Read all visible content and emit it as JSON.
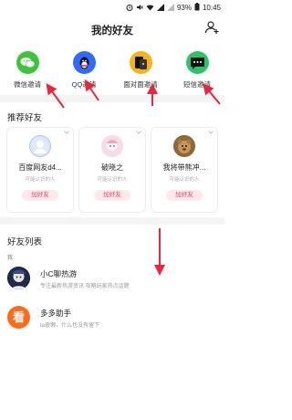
{
  "status_bar": {
    "battery_percent": "93%",
    "time": "10:45"
  },
  "header": {
    "title": "我的好友",
    "add_friend_icon": "person-add-icon"
  },
  "invites": [
    {
      "label": "微信邀请",
      "icon": "wechat-icon",
      "color": "#3ec43c"
    },
    {
      "label": "QQ邀请",
      "icon": "qq-icon",
      "color": "#2f6bff"
    },
    {
      "label": "面对面邀请",
      "icon": "face-to-face-icon",
      "color": "#f5b21a"
    },
    {
      "label": "短信邀请",
      "icon": "sms-icon",
      "color": "#2bc46c"
    }
  ],
  "recommend": {
    "title": "推荐好友",
    "cards": [
      {
        "name": "百度网友d4...",
        "subtitle": "可能认识的人",
        "button": "加好友"
      },
      {
        "name": "破晓之",
        "subtitle": "可能认识的人",
        "button": "加好友"
      },
      {
        "name": "我将带熊冲...",
        "subtitle": "可能认识的人",
        "button": "加好友"
      }
    ]
  },
  "friends": {
    "title": "好友列表",
    "group": "我",
    "items": [
      {
        "name": "小C聊热游",
        "desc": "专注最新热游资讯 攻略玩家热点话题"
      },
      {
        "name": "多多助手",
        "desc": "ta很懒，什么也没有留下",
        "avatar_text": "看"
      }
    ]
  },
  "colors": {
    "accent": "#e8485f",
    "arrow": "#e8263c"
  }
}
